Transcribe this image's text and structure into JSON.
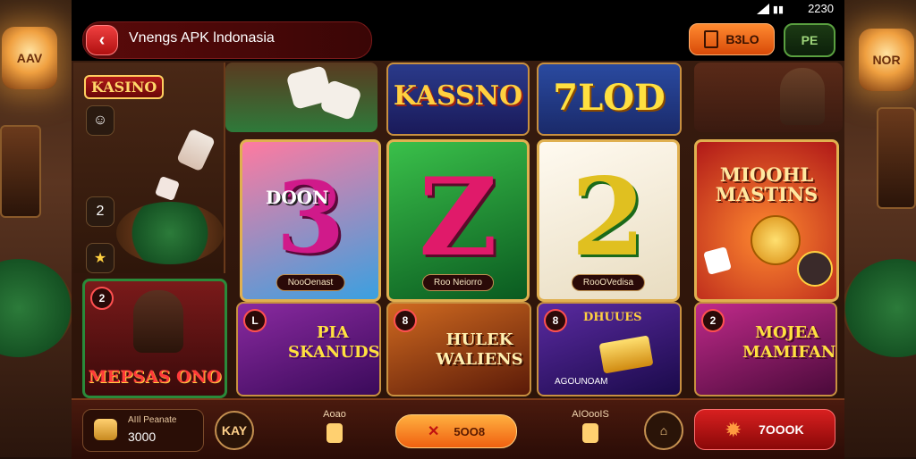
{
  "status_bar": {
    "time": "2230"
  },
  "header": {
    "title": "Vnengs APK lndonasia",
    "balance_label": "B3LO",
    "profile_label": "PE"
  },
  "sidebar": {
    "logo": "KASINO",
    "badges": [
      "2"
    ]
  },
  "top_row": {
    "kassno": "KASSNO",
    "jlod": "7LOD"
  },
  "featured": [
    {
      "glyph": "3",
      "overlay": "DOON",
      "tag": "",
      "caption": "NooOenast"
    },
    {
      "glyph": "Z",
      "overlay": "",
      "tag": "",
      "caption": "Roo Neiorro"
    },
    {
      "glyph": "2",
      "overlay": "",
      "tag": "",
      "caption": "RooOVedisa"
    },
    {
      "glyph": "",
      "overlay": "MIOOHL MASTINS",
      "tag": "",
      "caption": ""
    }
  ],
  "left_promo": {
    "badge": "2",
    "title": "MEPSAS ONO"
  },
  "bottom_tiles": [
    {
      "badge": "L",
      "title": "PIA SKANUDS"
    },
    {
      "badge": "8",
      "title": "HULEK WALIENS"
    },
    {
      "badge": "8",
      "title": "DHUUES",
      "caption": "AGOUNOAM"
    },
    {
      "badge": "2",
      "title": "MOJEA MAMIFAN"
    }
  ],
  "bottom_bar": {
    "wallet_label": "AIIl Peanate",
    "wallet_value": "3000",
    "icon_left": "KAY",
    "mini_label_1": "Aoao",
    "spin_label": "5OO8",
    "mini_label_2": "AIOooIS",
    "red_label": "7OOOK"
  },
  "colors": {
    "accent_orange": "#f06010",
    "accent_red": "#d82020",
    "accent_gold": "#ffd76a",
    "accent_green": "#5aa040"
  }
}
